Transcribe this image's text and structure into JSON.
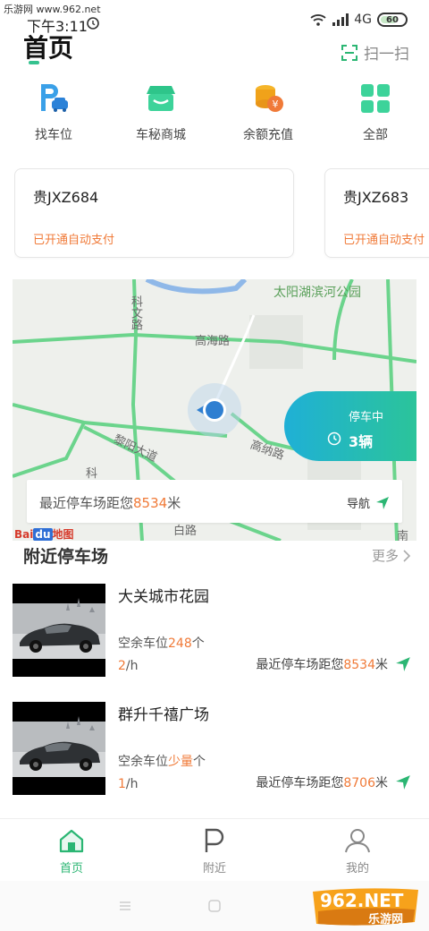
{
  "status_bar": {
    "watermark": "乐游网 www.962.net",
    "time": "下午3:11",
    "network": "4G",
    "battery": "60"
  },
  "header": {
    "title": "首页",
    "scan_label": "扫一扫"
  },
  "quick_menu": [
    {
      "label": "找车位",
      "icon": "parking-car-icon"
    },
    {
      "label": "车秘商城",
      "icon": "shop-icon"
    },
    {
      "label": "余额充值",
      "icon": "coins-icon"
    },
    {
      "label": "全部",
      "icon": "grid-icon"
    }
  ],
  "plates": [
    {
      "number": "贵JXZ684",
      "status": "已开通自动支付"
    },
    {
      "number": "贵JXZ683",
      "status": "已开通自动支付"
    }
  ],
  "map": {
    "park_label": "太阳湖滨河公园",
    "roads": [
      "高海路",
      "科文路",
      "黎阳大道",
      "高纳路",
      "科",
      "白路",
      "南"
    ],
    "parking_status": "停车中",
    "parking_count": "3辆",
    "nearest_prefix": "最近停车场距您",
    "nearest_distance": "8534",
    "nearest_unit": "米",
    "nav_label": "导航",
    "logo_text": "Bai 地图"
  },
  "nearby": {
    "title": "附近停车场",
    "more_label": "更多",
    "spaces_prefix": "空余车位",
    "spaces_suffix": "个",
    "price_suffix": "/h",
    "distance_prefix": "最近停车场距您",
    "distance_unit": "米",
    "lots": [
      {
        "name": "大关城市花园",
        "spaces": "248",
        "price": "2",
        "distance": "8534"
      },
      {
        "name": "群升千禧广场",
        "spaces": "少量",
        "price": "1",
        "distance": "8706"
      }
    ]
  },
  "tabs": [
    {
      "label": "首页",
      "active": true
    },
    {
      "label": "附近",
      "active": false
    },
    {
      "label": "我的",
      "active": false
    }
  ],
  "watermark_logo": {
    "brand": "962.NET",
    "sub": "乐游网"
  },
  "colors": {
    "accent_green": "#2bb673",
    "accent_orange": "#f07a38",
    "teal": "#1fb0d6"
  }
}
